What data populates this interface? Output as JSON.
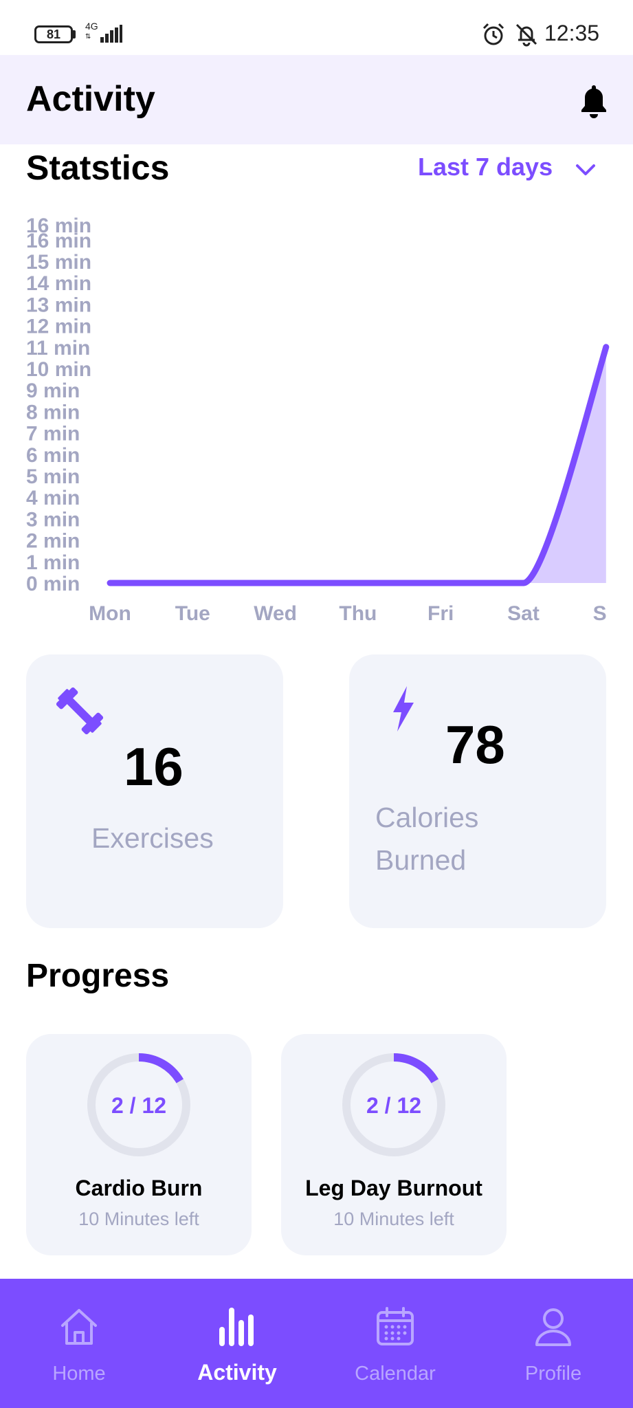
{
  "status_bar": {
    "battery": "81",
    "network": "4G",
    "time": "12:35"
  },
  "header": {
    "title": "Activity",
    "bell_icon": "bell-icon"
  },
  "statistics": {
    "title": "Statstics",
    "range": "Last 7 days"
  },
  "chart_data": {
    "type": "area",
    "categories": [
      "Mon",
      "Tue",
      "Wed",
      "Thu",
      "Fri",
      "Sat",
      "Su"
    ],
    "series": [
      {
        "values": [
          0,
          0,
          0,
          0,
          0,
          0,
          11
        ]
      }
    ],
    "y_ticks": [
      "0 min",
      "1 min",
      "2 min",
      "3 min",
      "4 min",
      "5 min",
      "6 min",
      "7 min",
      "8 min",
      "9 min",
      "10 min",
      "11 min",
      "12 min",
      "13 min",
      "14 min",
      "15 min",
      "16 min",
      "16 min"
    ],
    "ylim": [
      0,
      17
    ],
    "line_color": "#7c4dff",
    "fill_color": "#d9ccff"
  },
  "stats": {
    "exercises": {
      "value": "16",
      "label": "Exercises",
      "icon": "dumbbell-icon"
    },
    "calories": {
      "value": "78",
      "label_line1": "Calories",
      "label_line2": "Burned",
      "icon": "lightning-icon"
    }
  },
  "progress": {
    "title": "Progress",
    "items": [
      {
        "count": "2 / 12",
        "done": 2,
        "total": 12,
        "name": "Cardio Burn",
        "subtitle": "10 Minutes left"
      },
      {
        "count": "2 / 12",
        "done": 2,
        "total": 12,
        "name": "Leg Day Burnout",
        "subtitle": "10 Minutes left"
      }
    ]
  },
  "nav": {
    "items": [
      {
        "label": "Home",
        "icon": "home-icon"
      },
      {
        "label": "Activity",
        "icon": "bar-chart-icon",
        "active": true
      },
      {
        "label": "Calendar",
        "icon": "calendar-icon"
      },
      {
        "label": "Profile",
        "icon": "person-icon"
      }
    ]
  },
  "colors": {
    "accent": "#7c4dff",
    "muted": "#a3a6c2",
    "card": "#f2f4fa",
    "header_bg": "#f3f0fe"
  }
}
